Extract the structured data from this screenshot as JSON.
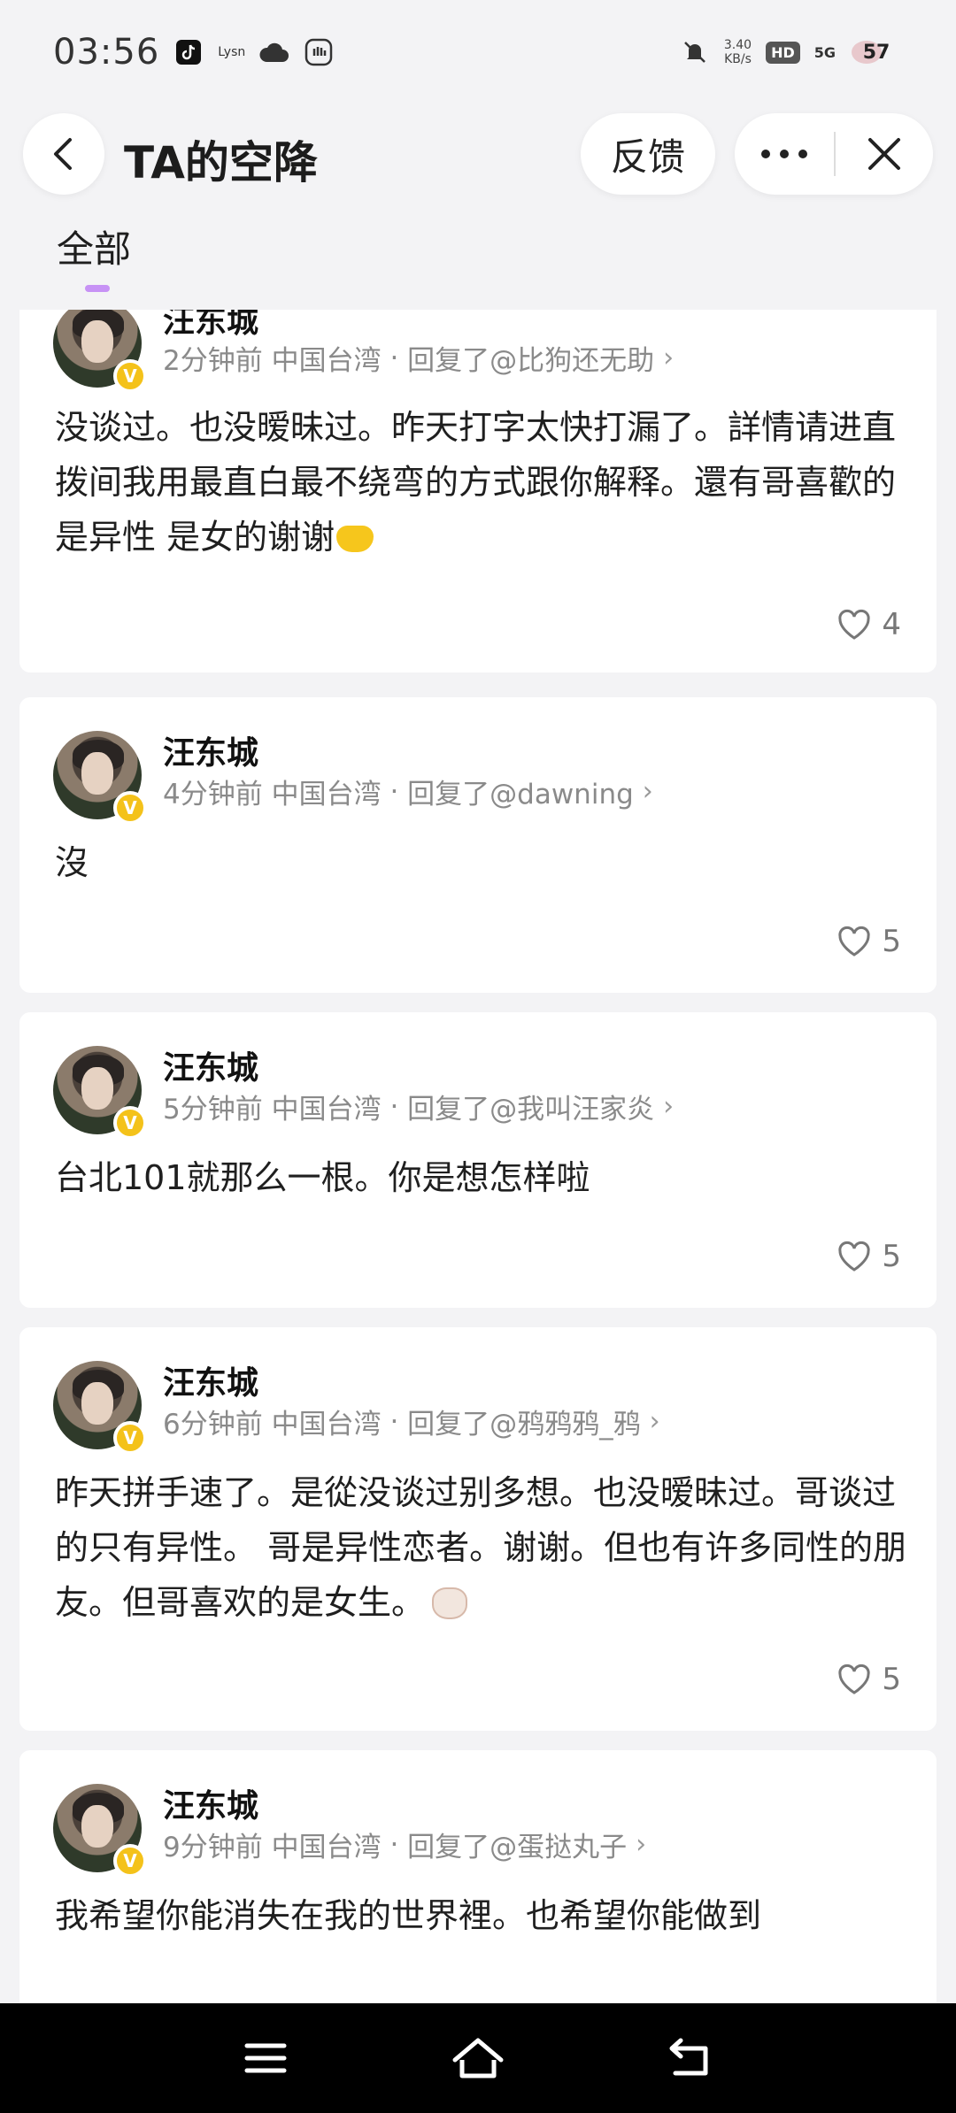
{
  "status_bar": {
    "time": "03:56",
    "lysn": "Lysn",
    "net_speed_value": "3.40",
    "net_speed_unit": "KB/s",
    "hd": "HD",
    "network": "5G",
    "battery": "57"
  },
  "header": {
    "title": "TA的空降",
    "feedback_label": "反馈"
  },
  "tabs": [
    {
      "label": "全部",
      "active": true
    }
  ],
  "comments": [
    {
      "username": "汪东城",
      "time": "2分钟前",
      "location": "中国台湾",
      "reply": "回复了@比狗还无助",
      "content": "没谈过。也没暧昧过。昨天打字太快打漏了。詳情请进直拨间我用最直白最不绕弯的方式跟你解释。還有哥喜歡的是异性 是女的谢谢",
      "likes": "4"
    },
    {
      "username": "汪东城",
      "time": "4分钟前",
      "location": "中国台湾",
      "reply": "回复了@dawning",
      "content": "沒",
      "likes": "5"
    },
    {
      "username": "汪东城",
      "time": "5分钟前",
      "location": "中国台湾",
      "reply": "回复了@我叫汪家炎",
      "content": "台北101就那么一根。你是想怎样啦",
      "likes": "5"
    },
    {
      "username": "汪东城",
      "time": "6分钟前",
      "location": "中国台湾",
      "reply": "回复了@鸦鸦鸦_鸦",
      "content": "昨天拼手速了。是從没谈过别多想。也没暧昧过。哥谈过的只有异性。 哥是异性恋者。谢谢。但也有许多同性的朋友。但哥喜欢的是女生。",
      "likes": "5"
    },
    {
      "username": "汪东城",
      "time": "9分钟前",
      "location": "中国台湾",
      "reply": "回复了@蛋挞丸子",
      "content": "我希望你能消失在我的世界裡。也希望你能做到",
      "likes": ""
    }
  ],
  "colors": {
    "background": "#f3f3f5",
    "accent": "#c792f5",
    "badge": "#f4c21a"
  },
  "icons": [
    "back-icon",
    "more-icon",
    "close-icon",
    "heart-icon",
    "verified-badge",
    "menu-icon",
    "home-icon",
    "return-icon"
  ]
}
